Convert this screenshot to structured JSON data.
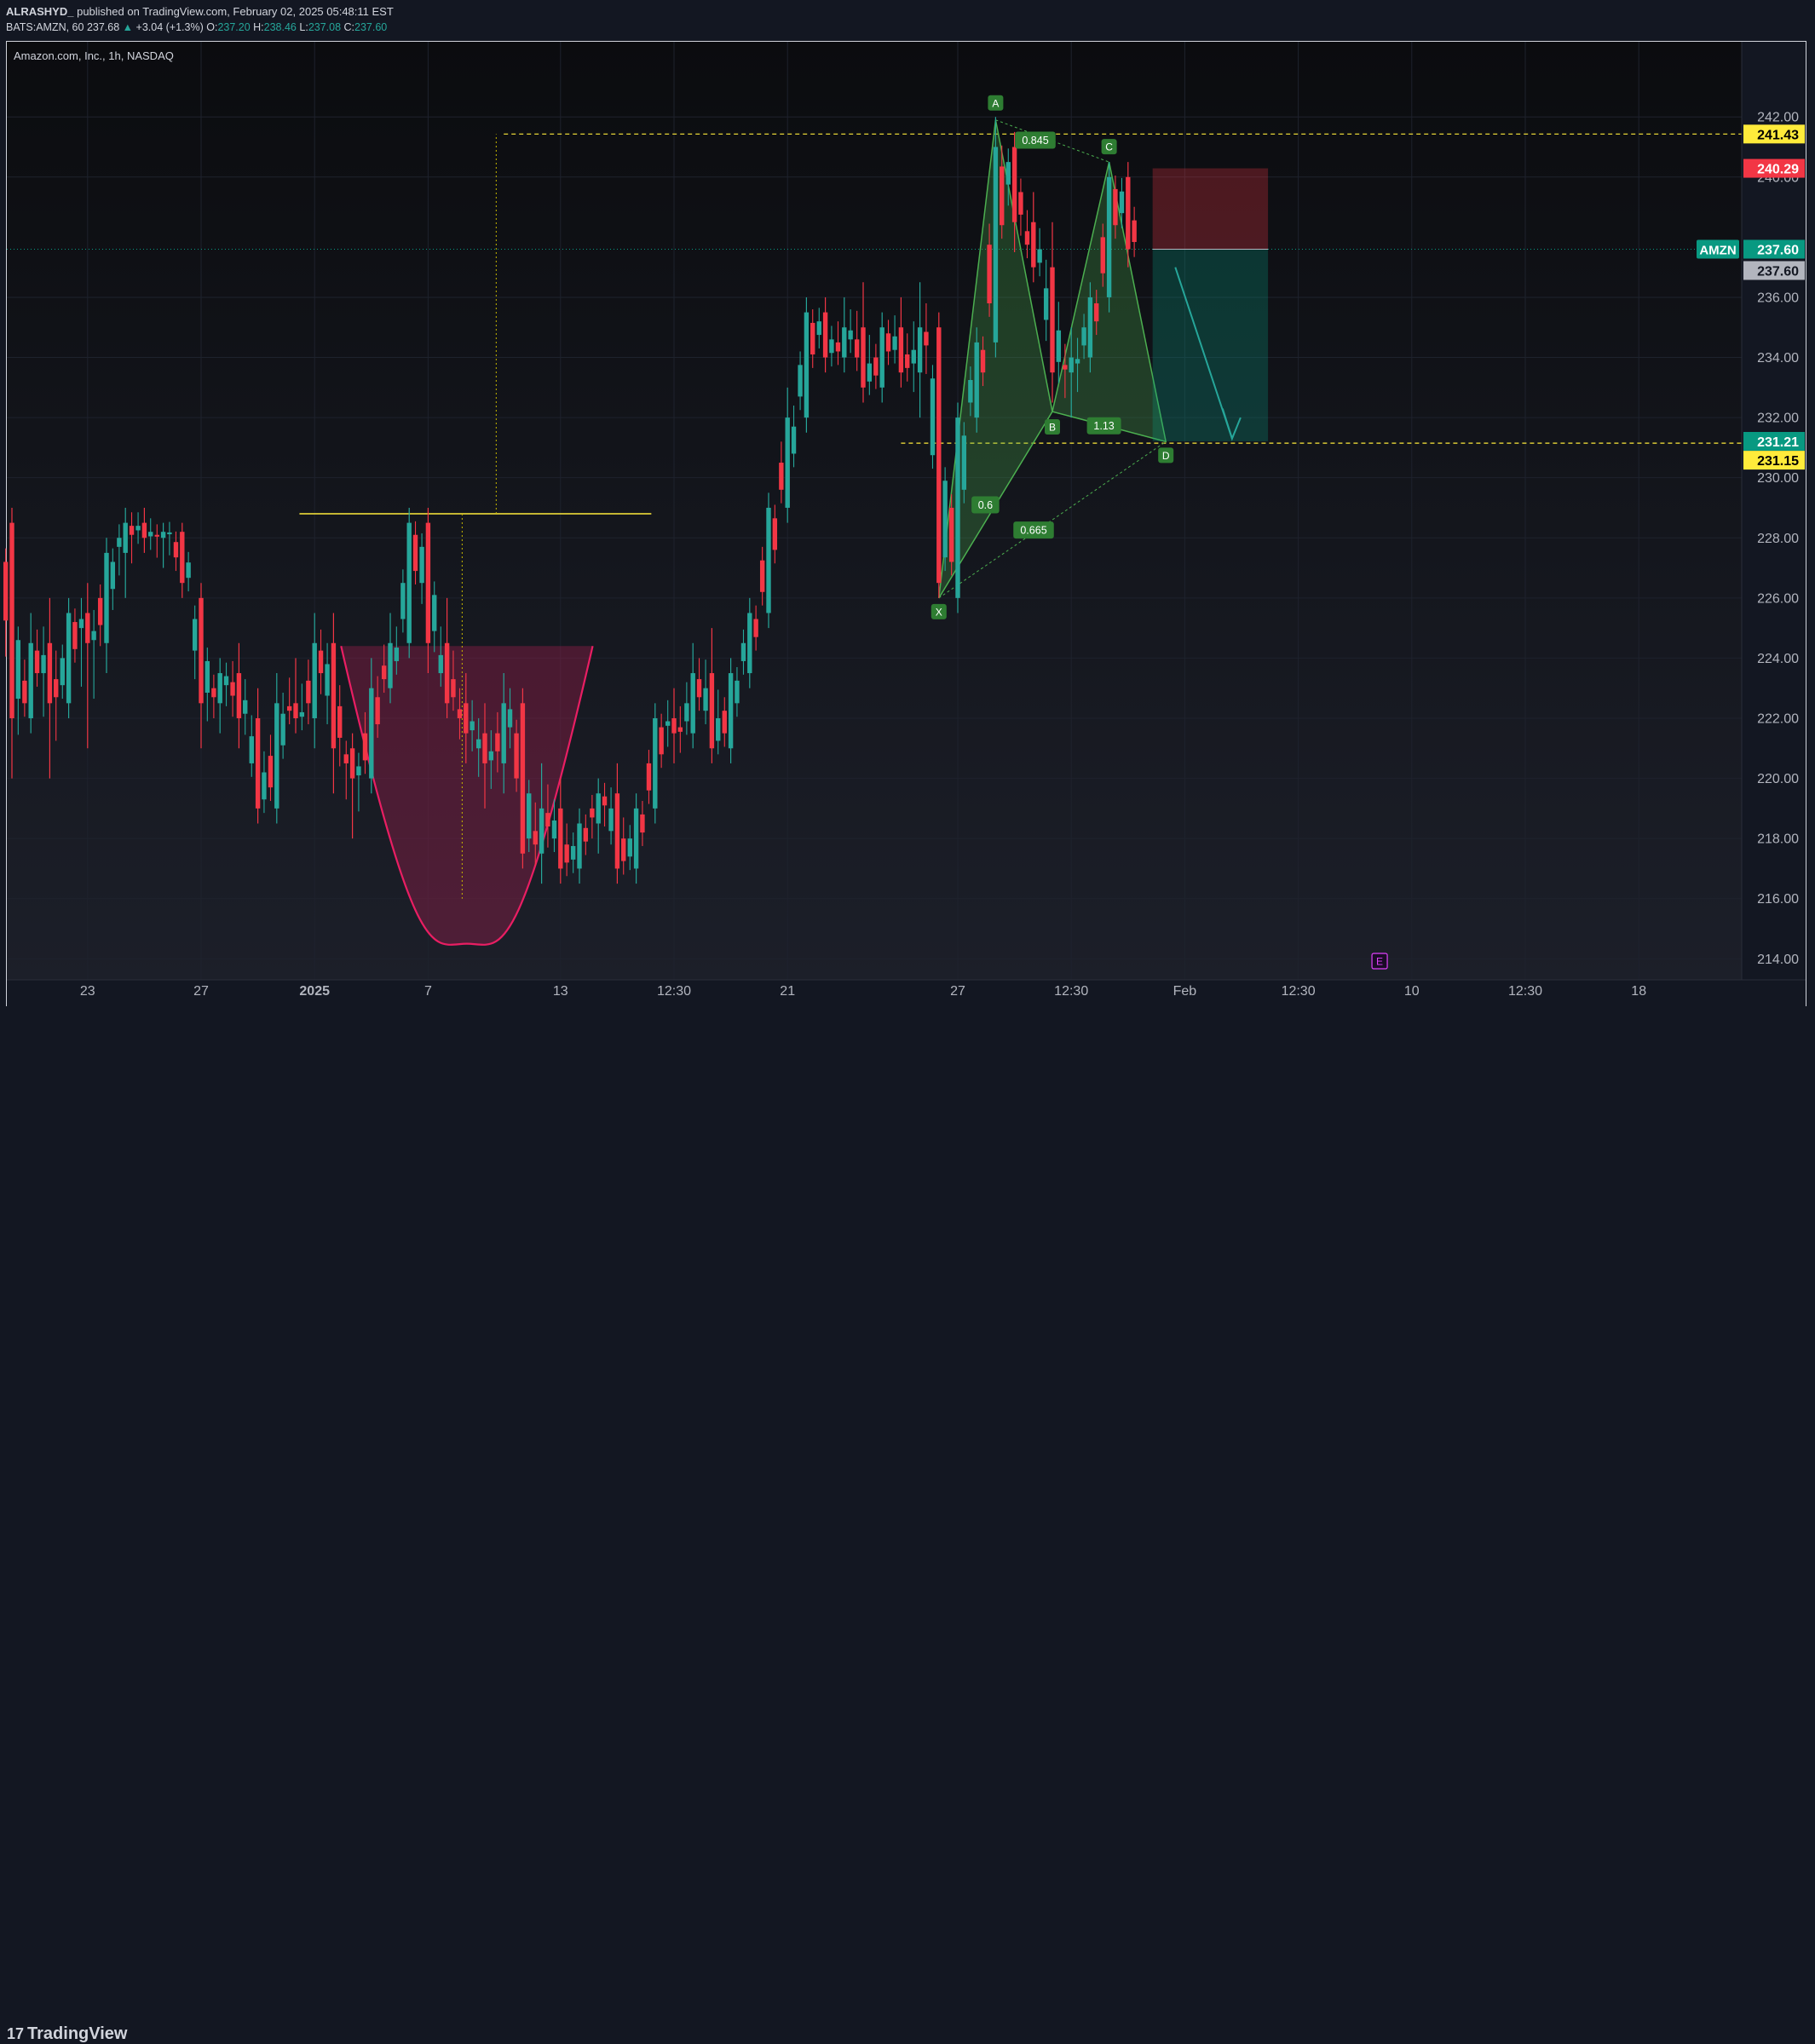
{
  "header": {
    "publisher": "ALRASHYD_",
    "published_text": "published on TradingView.com, February 02, 2025 05:48:11 EST",
    "symbol_line": "BATS:AMZN, 60",
    "last": "237.68",
    "change": "+3.04 (+1.3%)",
    "open_label": "O:",
    "open": "237.20",
    "high_label": "H:",
    "high": "238.46",
    "low_label": "L:",
    "low": "237.08",
    "close_label": "C:",
    "close": "237.60"
  },
  "footer": {
    "brand": "TradingView"
  },
  "chart_data": {
    "type": "candlestick",
    "title": "Amazon.com, Inc., 1h, NASDAQ",
    "ylim": [
      213.3,
      244.5
    ],
    "y_ticks": [
      214,
      216,
      218,
      220,
      222,
      224,
      226,
      228,
      230,
      232,
      234,
      236,
      240,
      242
    ],
    "x_ticks": [
      {
        "label": "23",
        "i": 4
      },
      {
        "label": "27",
        "i": 10
      },
      {
        "label": "2025",
        "i": 16,
        "bold": true
      },
      {
        "label": "7",
        "i": 22
      },
      {
        "label": "13",
        "i": 29
      },
      {
        "label": "12:30",
        "i": 35
      },
      {
        "label": "21",
        "i": 41
      },
      {
        "label": "27",
        "i": 50
      },
      {
        "label": "12:30",
        "i": 56
      },
      {
        "label": "Feb",
        "i": 62
      },
      {
        "label": "12:30",
        "i": 68
      },
      {
        "label": "10",
        "i": 74
      },
      {
        "label": "12:30",
        "i": 80
      },
      {
        "label": "18",
        "i": 86
      }
    ],
    "colors": {
      "up": "#26a69a",
      "down": "#f23645",
      "background": "#131722",
      "grid": "#1e222d"
    },
    "ohlc": [
      [
        228.5,
        229.0,
        220.0,
        222.0
      ],
      [
        222.0,
        225.5,
        221.5,
        224.5
      ],
      [
        224.5,
        226.0,
        220.0,
        222.5
      ],
      [
        222.5,
        226.0,
        222.0,
        225.5
      ],
      [
        225.5,
        226.5,
        221.0,
        224.5
      ],
      [
        224.5,
        228.0,
        223.5,
        227.5
      ],
      [
        227.5,
        229.0,
        226.0,
        228.5
      ],
      [
        228.5,
        229.0,
        227.5,
        228.0
      ],
      [
        228.0,
        228.5,
        227.0,
        228.2
      ],
      [
        228.2,
        228.5,
        226.0,
        226.5
      ],
      [
        226.0,
        226.5,
        221.0,
        222.5
      ],
      [
        222.5,
        224.0,
        221.5,
        223.5
      ],
      [
        223.5,
        224.5,
        221.0,
        222.0
      ],
      [
        222.0,
        223.0,
        218.5,
        219.0
      ],
      [
        219.0,
        223.5,
        218.5,
        222.5
      ],
      [
        222.5,
        224.0,
        221.5,
        222.0
      ],
      [
        222.0,
        225.5,
        221.0,
        224.5
      ],
      [
        224.5,
        225.5,
        219.5,
        221.0
      ],
      [
        221.0,
        221.5,
        218.0,
        220.0
      ],
      [
        220.0,
        224.0,
        219.5,
        223.0
      ],
      [
        223.0,
        225.5,
        222.5,
        224.5
      ],
      [
        224.5,
        229.0,
        224.0,
        228.5
      ],
      [
        228.5,
        229.0,
        223.5,
        224.5
      ],
      [
        224.5,
        226.0,
        222.0,
        222.5
      ],
      [
        222.5,
        223.5,
        220.5,
        221.5
      ],
      [
        221.5,
        222.5,
        219.0,
        220.5
      ],
      [
        220.5,
        223.5,
        219.5,
        222.5
      ],
      [
        222.5,
        223.0,
        217.0,
        217.5
      ],
      [
        217.5,
        220.5,
        216.5,
        219.0
      ],
      [
        219.0,
        220.0,
        216.5,
        217.0
      ],
      [
        217.0,
        219.0,
        216.5,
        218.5
      ],
      [
        218.5,
        220.0,
        217.5,
        219.5
      ],
      [
        219.5,
        220.5,
        216.5,
        217.0
      ],
      [
        217.0,
        219.5,
        216.5,
        219.0
      ],
      [
        219.0,
        222.5,
        218.5,
        222.0
      ],
      [
        222.0,
        223.0,
        220.5,
        221.5
      ],
      [
        221.5,
        224.5,
        221.0,
        223.5
      ],
      [
        223.5,
        225.0,
        220.5,
        221.0
      ],
      [
        221.0,
        224.0,
        220.5,
        223.5
      ],
      [
        223.5,
        226.0,
        223.0,
        225.5
      ],
      [
        225.5,
        229.5,
        225.0,
        229.0
      ],
      [
        229.0,
        233.0,
        228.5,
        232.0
      ],
      [
        232.0,
        236.0,
        231.5,
        235.5
      ],
      [
        235.5,
        236.0,
        233.5,
        234.0
      ],
      [
        234.0,
        236.0,
        233.5,
        235.0
      ],
      [
        235.0,
        236.5,
        232.5,
        233.0
      ],
      [
        233.0,
        235.5,
        232.5,
        235.0
      ],
      [
        235.0,
        236.0,
        233.0,
        233.5
      ],
      [
        233.5,
        236.5,
        232.0,
        235.0
      ],
      [
        235.0,
        235.5,
        226.0,
        226.5
      ],
      [
        226.0,
        232.5,
        225.5,
        232.0
      ],
      [
        232.0,
        235.0,
        231.5,
        234.5
      ],
      [
        234.5,
        242.0,
        234.0,
        241.0
      ],
      [
        241.0,
        241.5,
        237.5,
        238.5
      ],
      [
        238.5,
        239.5,
        236.5,
        237.0
      ],
      [
        237.0,
        238.5,
        232.5,
        233.5
      ],
      [
        233.5,
        235.0,
        232.0,
        234.0
      ],
      [
        234.0,
        236.5,
        233.5,
        236.0
      ],
      [
        236.0,
        240.5,
        235.5,
        240.0
      ],
      [
        240.0,
        240.5,
        237.0,
        237.6
      ]
    ],
    "levels": [
      {
        "price": 241.43,
        "label": "241.43",
        "color": "#ffeb3b"
      },
      {
        "price": 231.15,
        "label": "231.15",
        "color": "#ffeb3b"
      }
    ],
    "price_labels": [
      {
        "price": 241.43,
        "text": "241.43",
        "bg": "#ffeb3b",
        "fg": "#000000"
      },
      {
        "price": 240.29,
        "text": "240.29",
        "bg": "#f23645",
        "fg": "#ffffff"
      },
      {
        "price": 237.6,
        "text": "237.60",
        "bg": "#089981",
        "fg": "#ffffff"
      },
      {
        "price": 237.6,
        "text": "237.60",
        "bg": "#b2b5be",
        "fg": "#131722"
      },
      {
        "price": 231.21,
        "text": "231.21",
        "bg": "#089981",
        "fg": "#ffffff"
      },
      {
        "price": 231.15,
        "text": "231.15",
        "bg": "#ffeb3b",
        "fg": "#000000"
      }
    ],
    "symbol_badge": "AMZN",
    "pattern": {
      "points": [
        {
          "name": "X",
          "i": 49,
          "price": 226.0
        },
        {
          "name": "A",
          "i": 52,
          "price": 241.9
        },
        {
          "name": "B",
          "i": 55,
          "price": 232.2
        },
        {
          "name": "C",
          "i": 58,
          "price": 240.5
        },
        {
          "name": "D",
          "i": 61,
          "price": 231.2
        }
      ],
      "ratios": [
        "0.845",
        "0.6",
        "0.665",
        "1.13"
      ]
    },
    "annotations": {
      "cup_bottom": 214.5,
      "resistance": 228.8,
      "earnings_marker": "E"
    }
  }
}
